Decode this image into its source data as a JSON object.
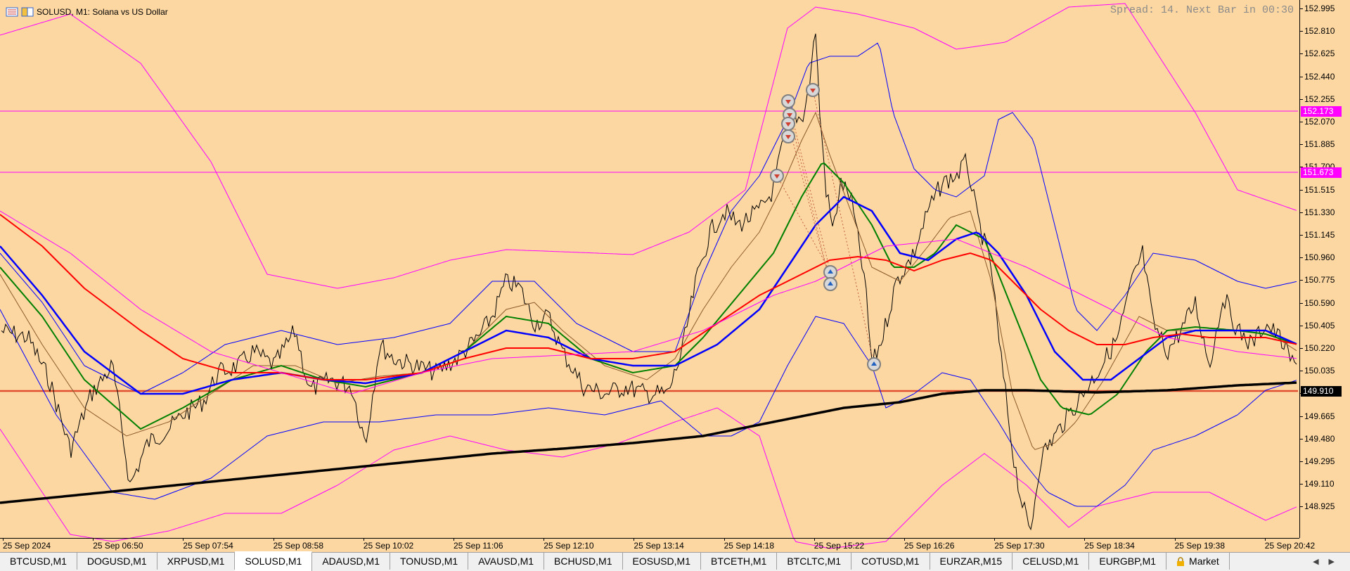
{
  "chart": {
    "symbol_label": "SOLUSD, M1:  Solana vs US Dollar",
    "spread_text": "Spread: 14. Next Bar in 00:30",
    "background": "#fdd7a2",
    "price_ticks": [
      "152.995",
      "152.810",
      "152.625",
      "152.440",
      "152.255",
      "152.070",
      "151.885",
      "151.700",
      "151.515",
      "151.330",
      "151.145",
      "150.960",
      "150.775",
      "150.590",
      "150.405",
      "150.220",
      "150.035",
      "149.850",
      "149.665",
      "149.480",
      "149.295",
      "149.110",
      "148.925"
    ],
    "price_tags": [
      {
        "label": "152.173",
        "color": "#ff00ff"
      },
      {
        "label": "151.673",
        "color": "#ff00ff"
      },
      {
        "label": "149.910",
        "color": "#000000"
      }
    ],
    "time_ticks": [
      "25 Sep 2024",
      "25 Sep 06:50",
      "25 Sep 07:54",
      "25 Sep 08:58",
      "25 Sep 10:02",
      "25 Sep 11:06",
      "25 Sep 12:10",
      "25 Sep 13:14",
      "25 Sep 14:18",
      "25 Sep 15:22",
      "25 Sep 16:26",
      "25 Sep 17:30",
      "25 Sep 18:34",
      "25 Sep 19:38",
      "25 Sep 20:42"
    ],
    "colors": {
      "price": "#000000",
      "ma_fast": "#8b5a2b",
      "ma_green": "#008000",
      "ma_blue": "#0000ff",
      "ma_red": "#ff0000",
      "ma_black": "#000000",
      "bands_blue": "#0000ff",
      "bands_magenta": "#ff00ff",
      "sell_marker": "#d04030",
      "buy_marker": "#2060c0"
    }
  },
  "tabs": [
    {
      "label": "BTCUSD,M1"
    },
    {
      "label": "DOGUSD,M1"
    },
    {
      "label": "XRPUSD,M1"
    },
    {
      "label": "SOLUSD,M1",
      "active": true
    },
    {
      "label": "ADAUSD,M1"
    },
    {
      "label": "TONUSD,M1"
    },
    {
      "label": "AVAUSD,M1"
    },
    {
      "label": "BCHUSD,M1"
    },
    {
      "label": "EOSUSD,M1"
    },
    {
      "label": "BTCETH,M1"
    },
    {
      "label": "BTCLTC,M1"
    },
    {
      "label": "COTUSD,M1"
    },
    {
      "label": "EURZAR,M15"
    },
    {
      "label": "CELUSD,M1"
    },
    {
      "label": "EURGBP,M1"
    }
  ],
  "market_tab": {
    "label": "Market",
    "icon": "lock-icon"
  },
  "tab_arrows": "◀▶"
}
